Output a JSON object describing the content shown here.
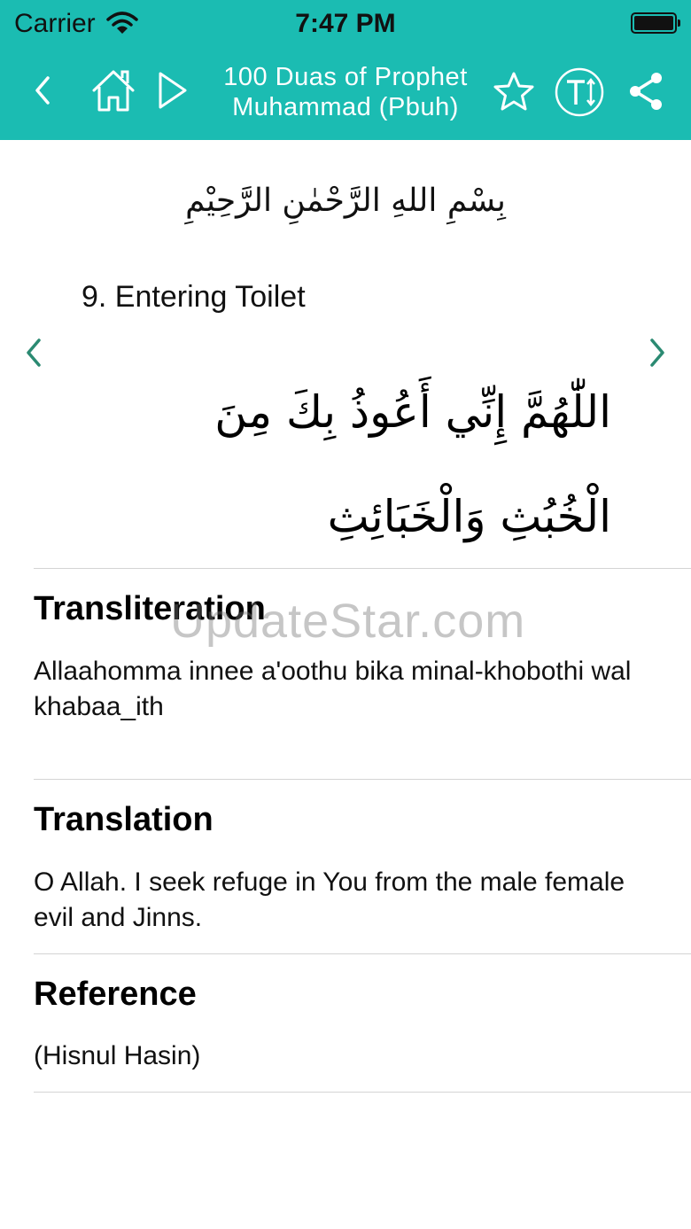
{
  "status_bar": {
    "carrier": "Carrier",
    "time": "7:47 PM"
  },
  "nav": {
    "title_line1": "100 Duas of Prophet",
    "title_line2": "Muhammad (Pbuh)",
    "icons": [
      "back-chevron-icon",
      "home-icon",
      "play-icon",
      "star-icon",
      "text-size-icon",
      "share-icon"
    ]
  },
  "dua": {
    "bismillah": "بِسْمِ اللهِ الرَّحْمٰنِ الرَّحِيْمِ",
    "title": "9. Entering Toilet",
    "arabic_line1": "اللّٰهُمَّ إِنِّي أَعُوذُ بِكَ مِنَ",
    "arabic_line2": "الْخُبُثِ وَالْخَبَائِثِ"
  },
  "sections": {
    "transliteration": {
      "title": "Transliteration",
      "text": "Allaahomma innee a'oothu bika minal-khobothi wal khabaa_ith"
    },
    "translation": {
      "title": "Translation",
      "text": "O Allah. I seek refuge in You from the male female evil and Jinns."
    },
    "reference": {
      "title": "Reference",
      "text": "(Hisnul Hasin)"
    }
  },
  "watermark": "UpdateStar.com",
  "colors": {
    "header_bg": "#1bbcb2",
    "arrow_green": "#2b8a72"
  }
}
